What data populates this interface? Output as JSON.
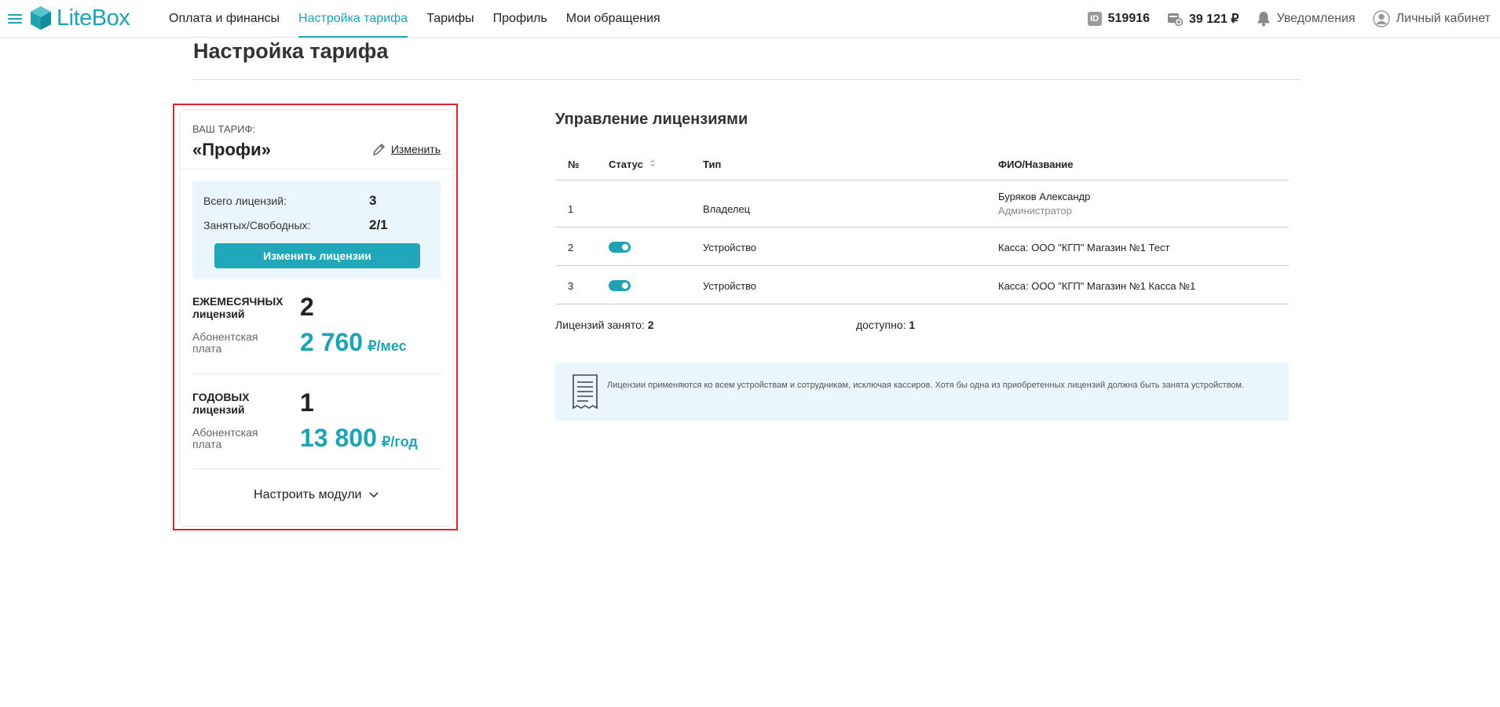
{
  "header": {
    "logo_text": "LiteBox",
    "nav": [
      "Оплата и финансы",
      "Настройка тарифа",
      "Тарифы",
      "Профиль",
      "Мои обращения"
    ],
    "active_nav": "Настройка тарифа",
    "id_badge": "ID",
    "account_id": "519916",
    "balance": "39 121 ₽",
    "notifications": "Уведомления",
    "cabinet": "Личный кабинет"
  },
  "page": {
    "title": "Настройка тарифа"
  },
  "tariff": {
    "label": "ВАШ ТАРИФ:",
    "name": "«Профи»",
    "change": "Изменить",
    "licenses_total_label": "Всего лицензий:",
    "licenses_total": "3",
    "licenses_used_label": "Занятых/Свободных:",
    "licenses_used": "2/1",
    "change_licenses_button": "Изменить лицензии",
    "monthly": {
      "label": "ЕЖЕМЕСЯЧНЫХ лицензий",
      "count": "2",
      "fee_label": "Абонентская плата",
      "price": "2 760",
      "unit": "₽/мес"
    },
    "yearly": {
      "label": "ГОДОВЫХ лицензий",
      "count": "1",
      "fee_label": "Абонентская плата",
      "price": "13 800",
      "unit": "₽/год"
    },
    "modules": "Настроить модули"
  },
  "licenses": {
    "title": "Управление лицензиями",
    "columns": [
      "№",
      "Статус",
      "Тип",
      "ФИО/Название"
    ],
    "rows": [
      {
        "num": "1",
        "status": "",
        "type": "Владелец",
        "name": "Буряков Александр",
        "sub": "Администратор"
      },
      {
        "num": "2",
        "status": "on",
        "type": "Устройство",
        "name": "Касса: ООО \"КГП\" Магазин №1 Тест",
        "sub": ""
      },
      {
        "num": "3",
        "status": "on",
        "type": "Устройство",
        "name": "Касса: ООО \"КГП\" Магазин №1 Касса №1",
        "sub": ""
      }
    ],
    "occupied_label": "Лицензий занято:",
    "occupied": "2",
    "available_label": "доступно:",
    "available": "1",
    "info": "Лицензии применяются ко всем устройствам и сотрудникам, исключая кассиров. Хотя бы одна из приобретенных лицензий должна быть занята устройством."
  },
  "colors": {
    "accent": "#1fa3b4",
    "highlight": "#d9232d",
    "info_bg": "#eaf6fb"
  }
}
